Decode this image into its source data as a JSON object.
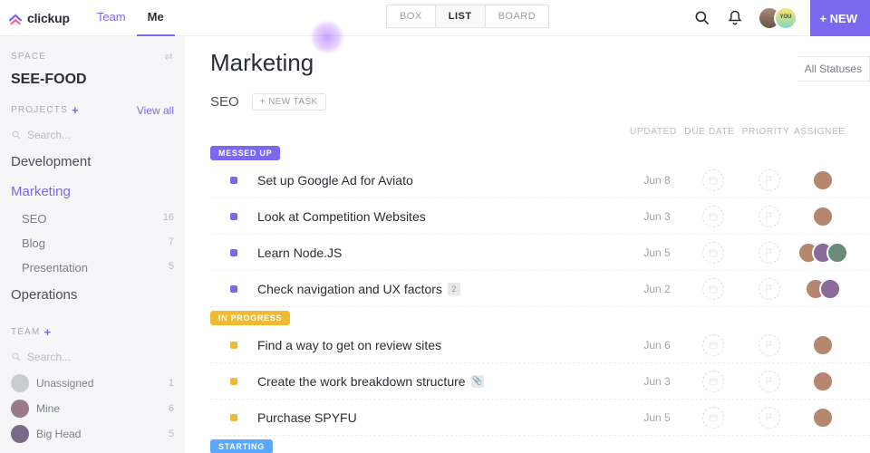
{
  "brand": {
    "name": "clickup"
  },
  "topnav": {
    "team": "Team",
    "me": "Me",
    "active": "me",
    "views": {
      "box": "BOX",
      "list": "LIST",
      "board": "BOARD",
      "active": "list"
    },
    "new_button": "+ NEW"
  },
  "sidebar": {
    "space_label": "SPACE",
    "space_name": "SEE-FOOD",
    "projects_label": "PROJECTS",
    "view_all": "View all",
    "search_placeholder": "Search...",
    "projects": [
      {
        "name": "Development",
        "active": false
      },
      {
        "name": "Marketing",
        "active": true,
        "lists": [
          {
            "name": "SEO",
            "count": "16"
          },
          {
            "name": "Blog",
            "count": "7"
          },
          {
            "name": "Presentation",
            "count": "5"
          }
        ]
      },
      {
        "name": "Operations",
        "active": false
      }
    ],
    "team_label": "TEAM",
    "team_search_placeholder": "Search...",
    "team": [
      {
        "name": "Unassigned",
        "count": "1",
        "color": "#c9ccd1"
      },
      {
        "name": "Mine",
        "count": "6",
        "color": "#9a7a8a"
      },
      {
        "name": "Big Head",
        "count": "5",
        "color": "#7a6a8a"
      }
    ]
  },
  "main": {
    "title": "Marketing",
    "statuses_button": "All Statuses",
    "list_name": "SEO",
    "new_task": "+ NEW TASK",
    "columns": {
      "updated": "UPDATED",
      "due": "DUE DATE",
      "priority": "PRIORITY",
      "assignee": "ASSIGNEE"
    },
    "groups": [
      {
        "status": "MESSED UP",
        "pill_class": "pill-messed",
        "sq": "purple",
        "tasks": [
          {
            "name": "Set up Google Ad for Aviato",
            "updated": "Jun 8",
            "assignees": 1
          },
          {
            "name": "Look at Competition Websites",
            "updated": "Jun 3",
            "assignees": 1
          },
          {
            "name": "Learn Node.JS",
            "updated": "Jun 5",
            "assignees": 3
          },
          {
            "name": "Check navigation and UX factors",
            "updated": "Jun 2",
            "assignees": 2,
            "chip": "2"
          }
        ]
      },
      {
        "status": "IN PROGRESS",
        "pill_class": "pill-progress",
        "sq": "yellow",
        "tasks": [
          {
            "name": "Find a way to get on review sites",
            "updated": "Jun 6",
            "assignees": 1
          },
          {
            "name": "Create the work breakdown structure",
            "updated": "Jun 3",
            "assignees": 1,
            "attach": true
          },
          {
            "name": "Purchase SPYFU",
            "updated": "Jun 5",
            "assignees": 1
          }
        ]
      },
      {
        "status": "STARTING",
        "pill_class": "pill-starting",
        "sq": "blue",
        "tasks": []
      }
    ]
  }
}
